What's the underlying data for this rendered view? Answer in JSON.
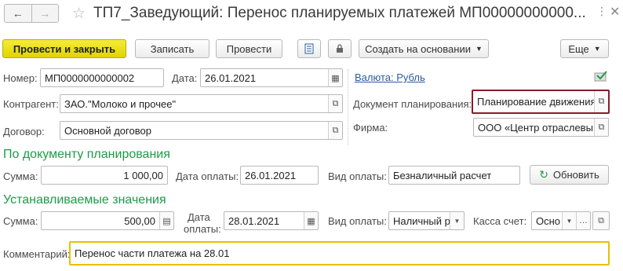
{
  "window": {
    "title": "ТП7_Заведующий: Перенос планируемых платежей МП00000000000..."
  },
  "toolbar": {
    "post_close": "Провести и закрыть",
    "save": "Записать",
    "post": "Провести",
    "create_based": "Создать на основании",
    "more": "Еще"
  },
  "header": {
    "number_label": "Номер:",
    "number_value": "МП0000000000002",
    "date_label": "Дата:",
    "date_value": "26.01.2021",
    "currency_link": "Валюта: Рубль",
    "counterparty_label": "Контрагент:",
    "counterparty_value": "ЗАО.\"Молоко и прочее\"",
    "plan_doc_label": "Документ планирования:",
    "plan_doc_value": "Планирование движения",
    "contract_label": "Договор:",
    "contract_value": "Основной договор",
    "firm_label": "Фирма:",
    "firm_value": "ООО «Центр отраслевы"
  },
  "by_plan": {
    "section_title": "По документу планирования",
    "sum_label": "Сумма:",
    "sum_value": "1 000,00",
    "paydate_label": "Дата оплаты:",
    "paydate_value": "26.01.2021",
    "paytype_label": "Вид оплаты:",
    "paytype_value": "Безналичный расчет",
    "refresh": "Обновить"
  },
  "set_values": {
    "section_title": "Устанавливаемые значения",
    "sum_label": "Сумма:",
    "sum_value": "500,00",
    "paydate_label_1": "Дата",
    "paydate_label_2": "оплаты:",
    "paydate_value": "28.01.2021",
    "paytype_label": "Вид оплаты:",
    "paytype_value": "Наличный р",
    "cash_label": "Касса счет:",
    "cash_value": "Осно"
  },
  "comment": {
    "label": "Комментарий:",
    "value": "Перенос части платежа на 28.01"
  },
  "colors": {
    "accent_yellow": "#e8dc00",
    "section_green": "#1f9a48",
    "focus_border": "#e8c000",
    "highlight_border": "#8b1a2a",
    "link_blue": "#2a5c9a"
  }
}
